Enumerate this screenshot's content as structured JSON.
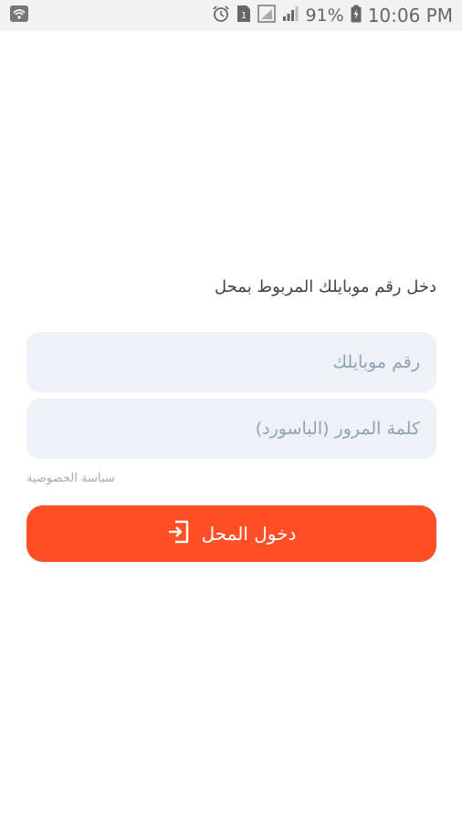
{
  "status_bar": {
    "battery_percent": "91%",
    "time": "10:06 PM",
    "icons": [
      "notification-icon",
      "alarm-icon",
      "sim-icon",
      "signal-icon",
      "battery-icon"
    ]
  },
  "login": {
    "instruction": "دخل رقم موبايلك المربوط بمحل",
    "phone_placeholder": "رقم موبايلك",
    "password_placeholder": "كلمة المرور (الباسورد)",
    "privacy_label": "سياسة الخصوصية",
    "submit_label": "دخول المحل",
    "submit_icon": "login-icon"
  },
  "colors": {
    "accent": "#ff4f27",
    "field_bg": "#eef2f6",
    "placeholder": "#8ea3b8"
  }
}
